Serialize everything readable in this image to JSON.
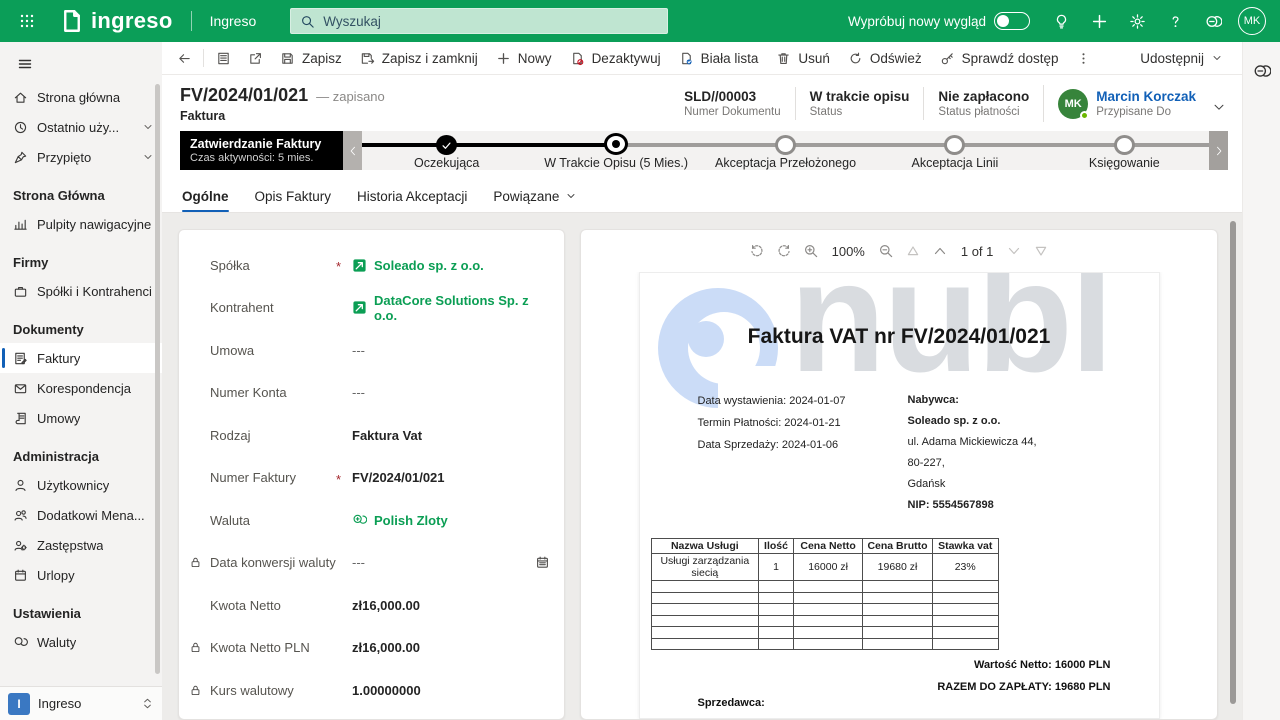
{
  "topbar": {
    "brand": "ingreso",
    "app_name": "Ingreso",
    "search_placeholder": "Wyszukaj",
    "new_look_label": "Wypróbuj nowy wygląd",
    "avatar_initials": "MK"
  },
  "command_bar": {
    "items": [
      {
        "label": "Zapisz"
      },
      {
        "label": "Zapisz i zamknij"
      },
      {
        "label": "Nowy"
      },
      {
        "label": "Dezaktywuj"
      },
      {
        "label": "Biała lista"
      },
      {
        "label": "Usuń"
      },
      {
        "label": "Odśwież"
      },
      {
        "label": "Sprawdź dostęp"
      }
    ],
    "share_label": "Udostępnij"
  },
  "record_header": {
    "title": "FV/2024/01/021",
    "saved_status": "— zapisano",
    "entity": "Faktura",
    "summary": [
      {
        "value": "SLD//00003",
        "label": "Numer Dokumentu"
      },
      {
        "value": "W trakcie opisu",
        "label": "Status"
      },
      {
        "value": "Nie zapłacono",
        "label": "Status płatności"
      },
      {
        "value": "Marcin Korczak",
        "label": "Przypisane Do",
        "initials": "MK"
      }
    ]
  },
  "bpf": {
    "name": "Zatwierdzanie Faktury",
    "active_time": "Czas aktywności: 5 mies.",
    "stages": [
      {
        "label": "Oczekująca"
      },
      {
        "label": "W Trakcie Opisu  (5 Mies.)"
      },
      {
        "label": "Akceptacja Przełożonego"
      },
      {
        "label": "Akceptacja Linii"
      },
      {
        "label": "Księgowanie"
      }
    ]
  },
  "tabs": [
    "Ogólne",
    "Opis Faktury",
    "Historia Akceptacji",
    "Powiązane"
  ],
  "sidebar": {
    "top_items": [
      {
        "label": "Strona główna"
      },
      {
        "label": "Ostatnio uży..."
      },
      {
        "label": "Przypięto"
      }
    ],
    "groups": [
      {
        "title": "Strona Główna",
        "items": [
          {
            "label": "Pulpity nawigacyjne"
          }
        ]
      },
      {
        "title": "Firmy",
        "items": [
          {
            "label": "Spółki i Kontrahenci"
          }
        ]
      },
      {
        "title": "Dokumenty",
        "items": [
          {
            "label": "Faktury"
          },
          {
            "label": "Korespondencja"
          },
          {
            "label": "Umowy"
          }
        ]
      },
      {
        "title": "Administracja",
        "items": [
          {
            "label": "Użytkownicy"
          },
          {
            "label": "Dodatkowi Mena..."
          },
          {
            "label": "Zastępstwa"
          },
          {
            "label": "Urlopy"
          }
        ]
      },
      {
        "title": "Ustawienia",
        "items": [
          {
            "label": "Waluty"
          }
        ]
      }
    ],
    "app_switcher": {
      "tile": "I",
      "label": "Ingreso"
    }
  },
  "form": {
    "required_mark": "*",
    "fields": [
      {
        "label": "Spółka",
        "value": "Soleado sp. z o.o."
      },
      {
        "label": "Kontrahent",
        "value": "DataCore Solutions Sp. z o.o."
      },
      {
        "label": "Umowa",
        "value": "---"
      },
      {
        "label": "Numer Konta",
        "value": "---"
      },
      {
        "label": "Rodzaj",
        "value": "Faktura Vat"
      },
      {
        "label": "Numer Faktury",
        "value": "FV/2024/01/021"
      },
      {
        "label": "Waluta",
        "value": "Polish Zloty"
      },
      {
        "label": "Data konwersji waluty",
        "value": "---"
      },
      {
        "label": "Kwota Netto",
        "value": "zł16,000.00"
      },
      {
        "label": "Kwota Netto PLN",
        "value": "zł16,000.00"
      },
      {
        "label": "Kurs walutowy",
        "value": "1.00000000"
      }
    ]
  },
  "viewer": {
    "zoom_level": "100%",
    "page_info": "1 of 1"
  },
  "invoice": {
    "watermark": "nubl",
    "title": "Faktura VAT nr FV/2024/01/021",
    "meta": [
      "Data wystawienia: 2024-01-07",
      "Termin Płatności: 2024-01-21",
      "Data Sprzedaży: 2024-01-06"
    ],
    "buyer_heading": "Nabywca:",
    "buyer_name": "Soleado sp. z o.o.",
    "buyer_lines": [
      "ul. Adama Mickiewicza 44,",
      "80-227,",
      "Gdańsk"
    ],
    "buyer_nip": "NIP: 5554567898",
    "table": {
      "columns": [
        "Nazwa Usługi",
        "Ilość",
        "Cena Netto",
        "Cena Brutto",
        "Stawka vat"
      ],
      "row": [
        "Usługi zarządzania siecią",
        "1",
        "16000 zł",
        "19680 zł",
        "23%"
      ]
    },
    "totals": {
      "net": "Wartość Netto: 16000 PLN",
      "due": "RAZEM DO ZAPŁATY: 19680 PLN"
    },
    "seller_heading": "Sprzedawca:"
  }
}
